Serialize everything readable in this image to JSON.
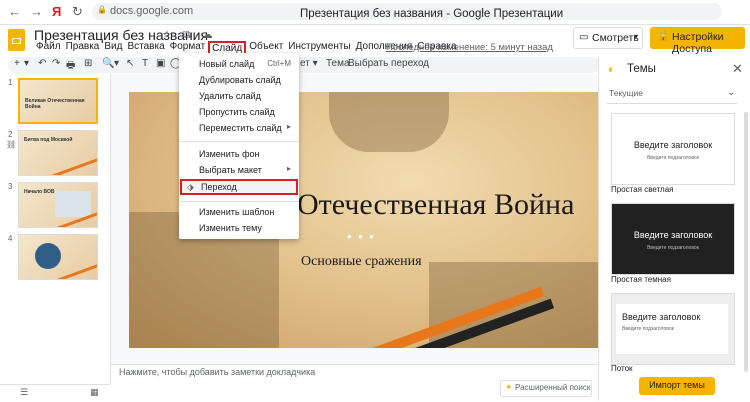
{
  "browser": {
    "url": "docs.google.com",
    "yandex_label": "Я",
    "nav_back": "←",
    "nav_forward": "→",
    "nav_reload": "↻",
    "lock_icon": "🔒"
  },
  "window_title": "Презентация без названия - Google Презентации",
  "doc": {
    "title": "Презентация без названия",
    "last_edit": "Последнее изменение: 5 минут назад"
  },
  "menubar": [
    "Файл",
    "Правка",
    "Вид",
    "Вставка",
    "Формат",
    "Слайд",
    "Объект",
    "Инструменты",
    "Дополнения",
    "Справка"
  ],
  "header": {
    "present_label": "Смотреть",
    "share_label": "Настройки Доступа"
  },
  "toolbar": {
    "items": [
      "+",
      "▾",
      "↶",
      "↷",
      "🖶",
      "⊞",
      "🔍",
      "▾",
      "↖",
      "T",
      "▣",
      "◯",
      "╲"
    ],
    "right_items": [
      "▾",
      "Тема",
      "Выбрать переход"
    ],
    "partial_layout": "ет ▾"
  },
  "slide_menu": {
    "items": [
      {
        "label": "Новый слайд",
        "shortcut": "Ctrl+M"
      },
      {
        "label": "Дублировать слайд",
        "shortcut": ""
      },
      {
        "label": "Удалить слайд",
        "shortcut": ""
      },
      {
        "label": "Пропустить слайд",
        "shortcut": ""
      },
      {
        "label": "Переместить слайд",
        "shortcut": "▸"
      }
    ],
    "items2": [
      {
        "label": "Изменить фон",
        "shortcut": ""
      },
      {
        "label": "Выбрать макет",
        "shortcut": "▸"
      },
      {
        "label": "Переход",
        "shortcut": ""
      }
    ],
    "items3": [
      {
        "label": "Изменить шаблон",
        "shortcut": ""
      },
      {
        "label": "Изменить тему",
        "shortcut": ""
      }
    ]
  },
  "filmstrip": {
    "numbers": [
      "1",
      "2",
      "3",
      "4"
    ],
    "titles": [
      "Великая Отечественная Война",
      "Битва под Москвой",
      "Начало ВОВ",
      ""
    ]
  },
  "slide": {
    "title": "Отечественная Война",
    "subtitle": "Основные сражения",
    "dots": "● ● ●"
  },
  "notes_placeholder": "Нажмите, чтобы добавить заметки докладчика",
  "explore_label": "Расширенный поиск",
  "themes": {
    "title": "Темы",
    "filter": "Текущие",
    "cards": [
      {
        "name": "Простая светлая",
        "heading": "Введите заголовок",
        "sub": "Введите подзаголовок",
        "bg": "#ffffff",
        "fg": "#202124"
      },
      {
        "name": "Простая темная",
        "heading": "Введите заголовок",
        "sub": "Введите подзаголовок",
        "bg": "#212121",
        "fg": "#ffffff"
      },
      {
        "name": "Поток",
        "heading": "Введите заголовок",
        "sub": "Введите подзаголовок",
        "bg": "#eeeeee",
        "fg": "#202124"
      }
    ],
    "import_label": "Импорт темы"
  },
  "colors": {
    "accent": "#f4b400",
    "highlight": "#d62027"
  }
}
